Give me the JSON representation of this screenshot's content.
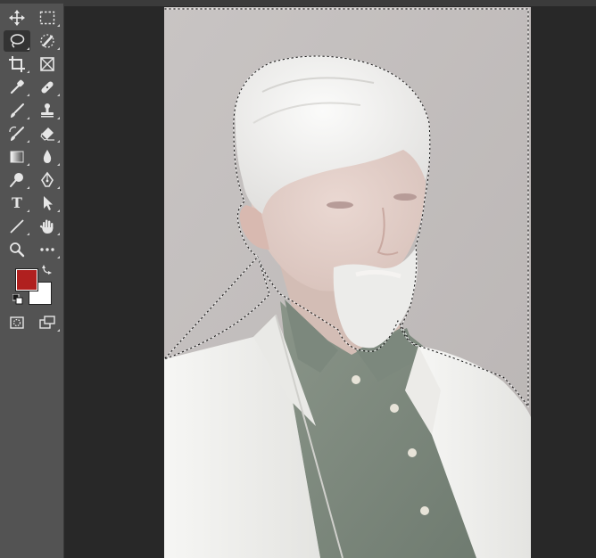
{
  "app": "photo-editor",
  "colors": {
    "toolbar_bg": "#535353",
    "workspace_bg": "#282828",
    "foreground_color": "#b0201f",
    "background_color": "#ffffff"
  },
  "toolbar": {
    "tools": [
      {
        "name": "move-tool",
        "icon": "move-icon",
        "active": false
      },
      {
        "name": "rectangular-marquee-tool",
        "icon": "marquee-icon",
        "active": false
      },
      {
        "name": "lasso-tool",
        "icon": "lasso-icon",
        "active": true
      },
      {
        "name": "quick-selection-tool",
        "icon": "quick-selection-icon",
        "active": false
      },
      {
        "name": "crop-tool",
        "icon": "crop-icon",
        "active": false
      },
      {
        "name": "frame-tool",
        "icon": "frame-icon",
        "active": false
      },
      {
        "name": "eyedropper-tool",
        "icon": "eyedropper-icon",
        "active": false
      },
      {
        "name": "healing-brush-tool",
        "icon": "bandage-icon",
        "active": false
      },
      {
        "name": "brush-tool",
        "icon": "brush-icon",
        "active": false
      },
      {
        "name": "clone-stamp-tool",
        "icon": "stamp-icon",
        "active": false
      },
      {
        "name": "history-brush-tool",
        "icon": "history-brush-icon",
        "active": false
      },
      {
        "name": "eraser-tool",
        "icon": "eraser-icon",
        "active": false
      },
      {
        "name": "gradient-tool",
        "icon": "gradient-icon",
        "active": false
      },
      {
        "name": "blur-tool",
        "icon": "drop-icon",
        "active": false
      },
      {
        "name": "dodge-tool",
        "icon": "dodge-icon",
        "active": false
      },
      {
        "name": "pen-tool",
        "icon": "pen-icon",
        "active": false
      },
      {
        "name": "type-tool",
        "icon": "type-icon",
        "glyph": "T",
        "active": false
      },
      {
        "name": "path-selection-tool",
        "icon": "arrow-icon",
        "active": false
      },
      {
        "name": "line-tool",
        "icon": "line-icon",
        "active": false
      },
      {
        "name": "hand-tool",
        "icon": "hand-icon",
        "active": false
      },
      {
        "name": "zoom-tool",
        "icon": "magnifier-icon",
        "active": false
      },
      {
        "name": "more-tools",
        "icon": "ellipsis-icon",
        "active": false
      },
      {
        "name": "quick-mask-mode",
        "icon": "quick-mask-icon",
        "active": false
      },
      {
        "name": "screen-mode",
        "icon": "screen-mode-icon",
        "active": false
      }
    ]
  },
  "document": {
    "subject": "portrait-photo",
    "selection_active": true
  }
}
